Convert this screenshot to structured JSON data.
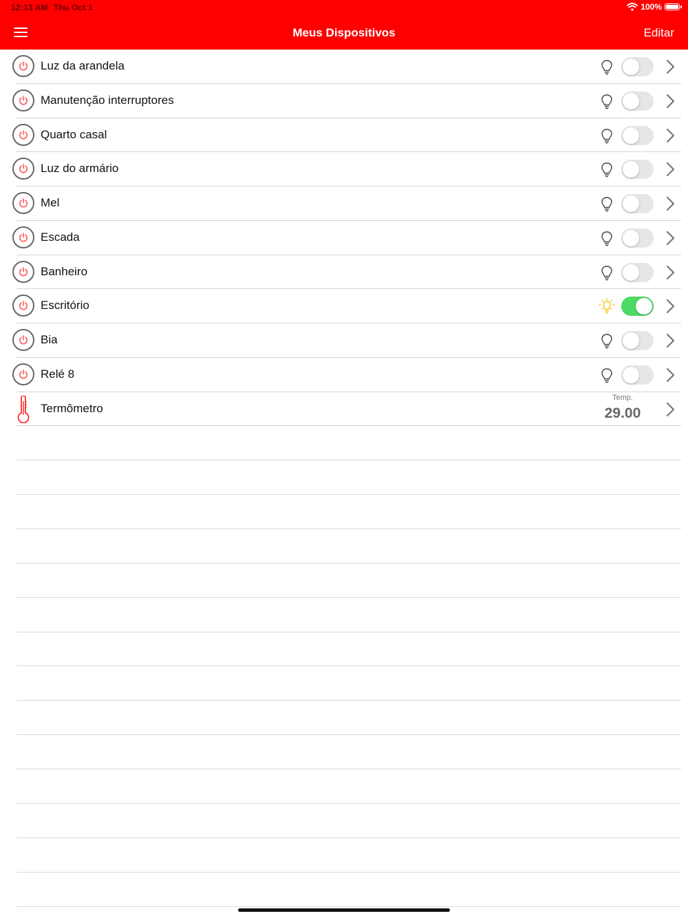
{
  "status_bar": {
    "time": "12:13 AM",
    "date": "Thu Oct 1",
    "battery": "100%"
  },
  "nav": {
    "title": "Meus Dispositivos",
    "edit_label": "Editar",
    "menu_icon": "hamburger-menu-icon"
  },
  "colors": {
    "accent": "#ff0000",
    "toggle_on": "#4cd964",
    "bulb_on": "#f5c518"
  },
  "devices": [
    {
      "label": "Luz da arandela",
      "on": false
    },
    {
      "label": "Manutenção interruptores",
      "on": false
    },
    {
      "label": "Quarto casal",
      "on": false
    },
    {
      "label": "Luz do armário",
      "on": false
    },
    {
      "label": "Mel",
      "on": false
    },
    {
      "label": "Escada",
      "on": false
    },
    {
      "label": "Banheiro",
      "on": false
    },
    {
      "label": "Escritório",
      "on": true
    },
    {
      "label": "Bia",
      "on": false
    },
    {
      "label": "Relé 8",
      "on": false
    }
  ],
  "thermometer": {
    "label": "Termômetro",
    "temp_caption": "Temp.",
    "temp_value": "29.00"
  }
}
